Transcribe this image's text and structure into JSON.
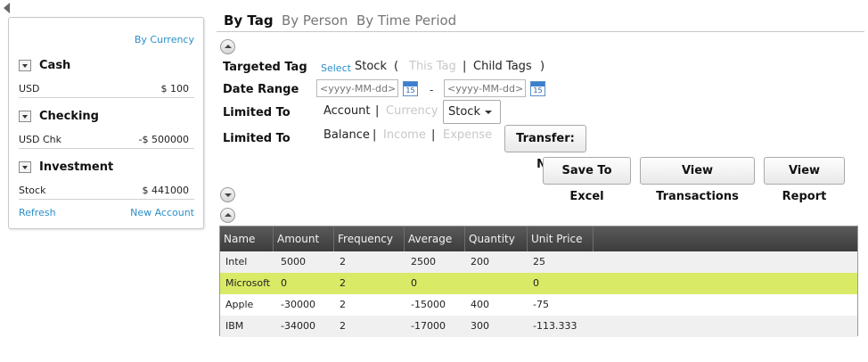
{
  "left_panel": {
    "by_currency": "By Currency",
    "groups": [
      {
        "title": "Cash",
        "rows": [
          {
            "name": "USD",
            "value": "$ 100"
          }
        ]
      },
      {
        "title": "Checking",
        "rows": [
          {
            "name": "USD Chk",
            "value": "-$ 500000"
          }
        ]
      },
      {
        "title": "Investment",
        "rows": [
          {
            "name": "Stock",
            "value": "$ 441000"
          }
        ]
      }
    ],
    "refresh": "Refresh",
    "new_account": "New Account"
  },
  "tabs": [
    {
      "label": "By Tag",
      "active": true
    },
    {
      "label": "By Person",
      "active": false
    },
    {
      "label": "By Time Period",
      "active": false
    }
  ],
  "form": {
    "targeted_tag": {
      "label": "Targeted Tag",
      "select_link": "Select",
      "value": "Stock",
      "open_paren": "(",
      "this_tag": "This Tag",
      "sep": "|",
      "child_tags": "Child Tags",
      "close_paren": ")"
    },
    "date_range": {
      "label": "Date Range",
      "from_placeholder": "<yyyy-MM-dd>",
      "to_placeholder": "<yyyy-MM-dd>",
      "calendar_day": "15",
      "dash": "-"
    },
    "limited_to_1": {
      "label": "Limited To",
      "account": "Account",
      "sep": "|",
      "currency": "Currency",
      "dropdown_value": "Stock"
    },
    "limited_to_2": {
      "label": "Limited To",
      "balance": "Balance",
      "sep": "|",
      "income": "Income",
      "expense": "Expense",
      "transfer_button": "Transfer: No"
    }
  },
  "actions": {
    "save_to_excel": "Save To Excel",
    "view_transactions": "View Transactions",
    "view_report": "View Report"
  },
  "table": {
    "columns": [
      "Name",
      "Amount",
      "Frequency",
      "Average",
      "Quantity",
      "Unit Price"
    ],
    "rows": [
      [
        "Intel",
        "5000",
        "2",
        "2500",
        "200",
        "25"
      ],
      [
        "Microsoft",
        "0",
        "2",
        "0",
        "",
        "0"
      ],
      [
        "Apple",
        "-30000",
        "2",
        "-15000",
        "400",
        "-75"
      ],
      [
        "IBM",
        "-34000",
        "2",
        "-17000",
        "300",
        "-113.333"
      ]
    ],
    "selected_row": 1,
    "selected_color": "#d9ea67",
    "header_color": "#4a4a4a"
  },
  "colors": {
    "link": "#2a8fc8",
    "disabled": "#c8c8c8"
  }
}
